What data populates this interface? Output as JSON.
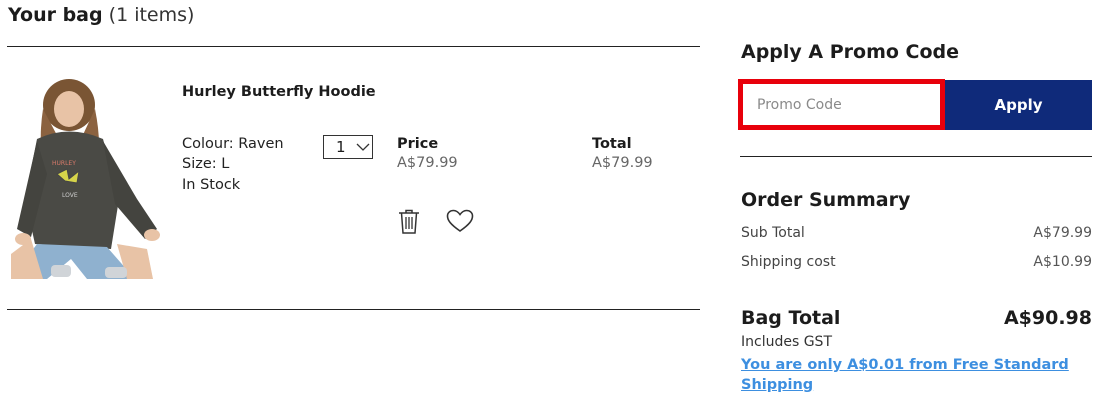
{
  "bag": {
    "title": "Your bag",
    "count_text": "(1 items)"
  },
  "item": {
    "name": "Hurley Butterfly Hoodie",
    "colour": "Colour: Raven",
    "size": "Size: L",
    "stock": "In Stock",
    "quantity": "1",
    "price_label": "Price",
    "price_value": "A$79.99",
    "total_label": "Total",
    "total_value": "A$79.99",
    "image_icon": "hoodie-product-photo",
    "delete_icon": "trash-icon",
    "wishlist_icon": "heart-icon"
  },
  "promo": {
    "title": "Apply A Promo Code",
    "placeholder": "Promo Code",
    "apply_label": "Apply"
  },
  "summary": {
    "title": "Order Summary",
    "subtotal_label": "Sub Total",
    "subtotal_value": "A$79.99",
    "shipping_label": "Shipping cost",
    "shipping_value": "A$10.99",
    "bag_total_label": "Bag Total",
    "bag_total_value": "A$90.98",
    "gst_note": "Includes GST",
    "free_shipping_link": "You are only A$0.01 from Free Standard Shipping"
  },
  "colors": {
    "apply_button": "#0f2a7a",
    "highlight_border": "#e8000b",
    "link": "#3d8fe0"
  }
}
